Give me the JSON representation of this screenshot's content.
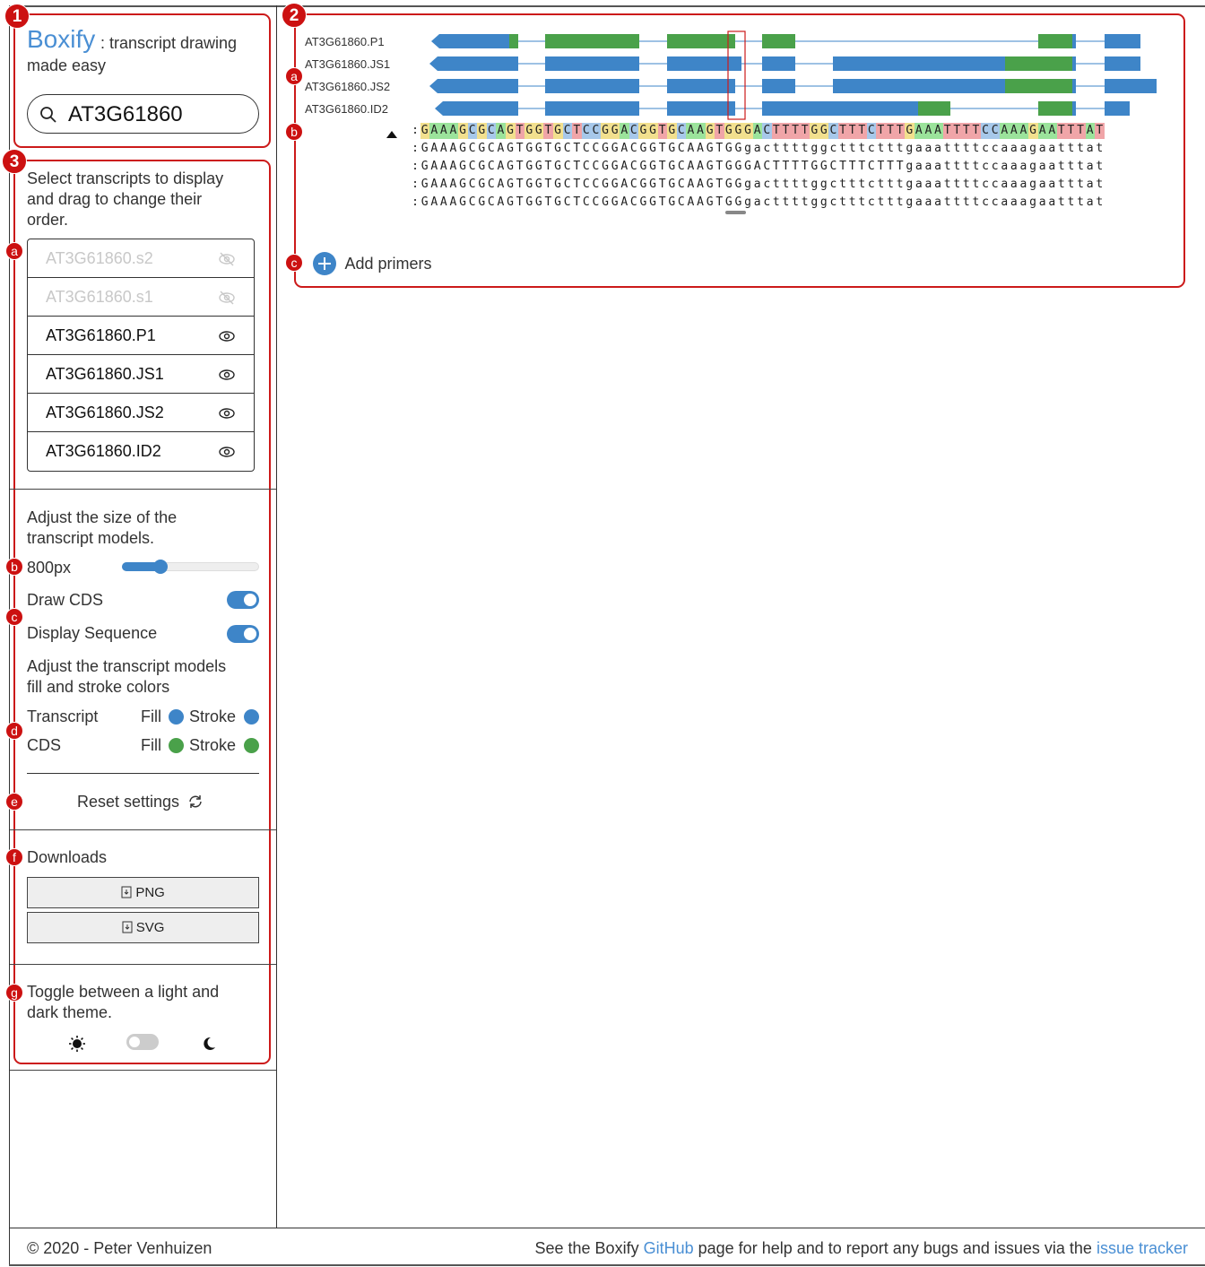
{
  "app": {
    "logo": "Boxify",
    "tagline_part1": ": transcript drawing",
    "tagline_part2": "made easy"
  },
  "search": {
    "value": "AT3G61860"
  },
  "panel_markers": {
    "search_panel": "1",
    "viewer_panel": "2",
    "settings_panel": "3"
  },
  "sub_markers": {
    "a": "a",
    "b": "b",
    "c": "c",
    "d": "d",
    "e": "e",
    "f": "f",
    "g": "g"
  },
  "transcripts": {
    "instructions_line1": "Select transcripts to display",
    "instructions_line2": "and drag to change their",
    "instructions_line3": "order.",
    "items": [
      {
        "label": "AT3G61860.s2",
        "visible": false,
        "icon": "eye-off-icon"
      },
      {
        "label": "AT3G61860.s1",
        "visible": false,
        "icon": "eye-off-icon"
      },
      {
        "label": "AT3G61860.P1",
        "visible": true,
        "icon": "eye-icon"
      },
      {
        "label": "AT3G61860.JS1",
        "visible": true,
        "icon": "eye-icon"
      },
      {
        "label": "AT3G61860.JS2",
        "visible": true,
        "icon": "eye-icon"
      },
      {
        "label": "AT3G61860.ID2",
        "visible": true,
        "icon": "eye-icon"
      }
    ]
  },
  "size": {
    "instructions_line1": "Adjust the size of the",
    "instructions_line2": "transcript models.",
    "value_label": "800px",
    "slider_fraction": 0.28
  },
  "draw_cds": {
    "label": "Draw CDS",
    "on": true
  },
  "display_sequence": {
    "label": "Display Sequence",
    "on": true
  },
  "colors": {
    "instructions_line1": "Adjust the transcript models",
    "instructions_line2": "fill and stroke colors",
    "transcript": {
      "label": "Transcript",
      "fill_label": "Fill",
      "stroke_label": "Stroke",
      "fill": "#3e85c8",
      "stroke": "#3e85c8"
    },
    "cds": {
      "label": "CDS",
      "fill_label": "Fill",
      "stroke_label": "Stroke",
      "fill": "#4aa14a",
      "stroke": "#4aa14a"
    }
  },
  "reset": {
    "label": "Reset settings",
    "icon": "refresh-icon"
  },
  "downloads": {
    "title": "Downloads",
    "png_label": "PNG",
    "svg_label": "SVG",
    "icon": "download-file-icon"
  },
  "theme": {
    "instructions_line1": "Toggle between a light and",
    "instructions_line2": "dark theme.",
    "light_icon": "sun-icon",
    "dark_icon": "moon-icon",
    "dark_on": false
  },
  "viewer": {
    "transcript_labels": [
      "AT3G61860.P1",
      "AT3G61860.JS1",
      "AT3G61860.JS2",
      "AT3G61860.ID2"
    ],
    "sequence_rows": [
      ":GAAAGCGCAGTGGTGCTCCGGACGGTGCAAGTGGGACTTTTGGCTTTCTTTGAAATTTTCCAAAGAATTTAT",
      ":GAAAGCGCAGTGGTGCTCCGGACGGTGCAAGTGGgacttttggctttctttgaaattttccaaagaatttat",
      ":GAAAGCGCAGTGGTGCTCCGGACGGTGCAAGTGGGACTTTTGGCTTTCTTTgaaattttccaaagaatttat",
      ":GAAAGCGCAGTGGTGCTCCGGACGGTGCAAGTGGgacttttggctttctttgaaattttccaaagaatttat",
      ":GAAAGCGCAGTGGTGCTCCGGACGGTGCAAGTGGgacttttggctttctttgaaattttccaaagaatttat"
    ],
    "base_colors": {
      "A": "#9be39b",
      "C": "#a7c8ea",
      "G": "#f2e08e",
      "T": "#f0a5a8"
    },
    "add_primers_label": "Add primers",
    "add_icon": "plus-circle-icon",
    "expand_icon": "triangle-up-icon"
  },
  "footer": {
    "copyright": "© 2020 - Peter Venhuizen",
    "help_prefix": "See the Boxify",
    "github_link": "GitHub",
    "help_middle": "page for help and to report any bugs and issues via the",
    "tracker_link": "issue tracker"
  }
}
